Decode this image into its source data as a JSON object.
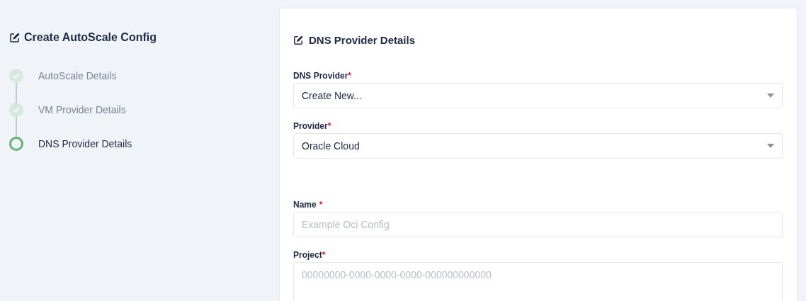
{
  "sidebar": {
    "title": "Create AutoScale Config",
    "steps": [
      {
        "label": "AutoScale Details",
        "completed": true,
        "current": false
      },
      {
        "label": "VM Provider Details",
        "completed": true,
        "current": false
      },
      {
        "label": "DNS Provider Details",
        "completed": false,
        "current": true
      }
    ]
  },
  "form": {
    "title": "DNS Provider Details",
    "fields": [
      {
        "kind": "select",
        "label": "DNS Provider",
        "mark": "*",
        "value": "Create New..."
      },
      {
        "kind": "select",
        "label": "Provider",
        "mark": "*",
        "value": "Oracle Cloud"
      },
      {
        "kind": "input",
        "label": "Name",
        "mark": "*",
        "placeholder": "Example Oci Config"
      },
      {
        "kind": "textarea",
        "label": "Project",
        "mark": "*",
        "placeholder": "00000000-0000-0000-0000-000000000000"
      }
    ]
  }
}
